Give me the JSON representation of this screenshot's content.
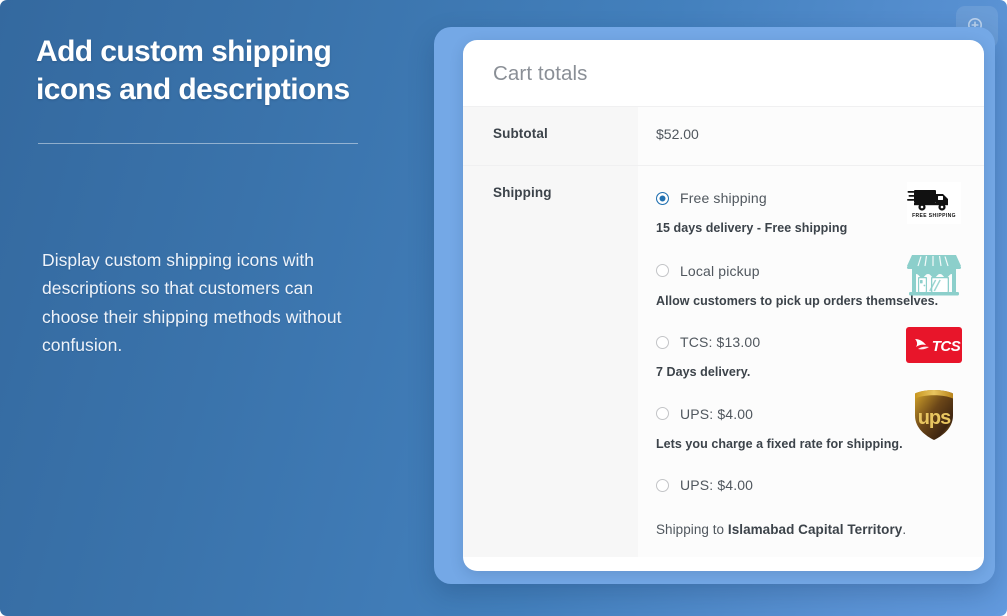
{
  "promo": {
    "headline_line1": "Add custom shipping",
    "headline_line2": "icons and descriptions",
    "body": "Display custom shipping icons with descriptions so that customers can choose their shipping methods without confusion."
  },
  "zoom_badge": {
    "icon": "zoom-in-icon"
  },
  "cart": {
    "title": "Cart totals",
    "rows": {
      "subtotal_label": "Subtotal",
      "subtotal_value": "$52.00",
      "shipping_label": "Shipping"
    },
    "shipping_options": [
      {
        "label": "Free shipping",
        "selected": true,
        "description": "15 days delivery - Free shipping",
        "icon": "free-shipping-truck-icon"
      },
      {
        "label": "Local pickup",
        "selected": false,
        "description": "Allow customers to pick up orders themselves.",
        "icon": "storefront-icon"
      },
      {
        "label": "TCS: $13.00",
        "selected": false,
        "description": "7 Days delivery.",
        "icon": "tcs-logo-icon"
      },
      {
        "label": "UPS: $4.00",
        "selected": false,
        "description": "Lets you charge a fixed rate for shipping.",
        "icon": "ups-shield-icon"
      },
      {
        "label": "UPS: $4.00",
        "selected": false,
        "description": "",
        "icon": ""
      }
    ],
    "shipping_to_prefix": "Shipping to ",
    "shipping_to_location": "Islamabad Capital Territory",
    "shipping_to_suffix": "."
  },
  "colors": {
    "background_blue_dark": "#34699f",
    "background_blue_light": "#629ade",
    "frame_blue": "#74a8e6",
    "card_white": "#ffffff",
    "radio_selected": "#2271b1",
    "label_cell_bg": "#f7f7f7",
    "tcs_red": "#e8152a",
    "ups_brown": "#4a2c14",
    "ups_gold": "#d4a21a",
    "storefront_teal": "#8ccfcb"
  }
}
